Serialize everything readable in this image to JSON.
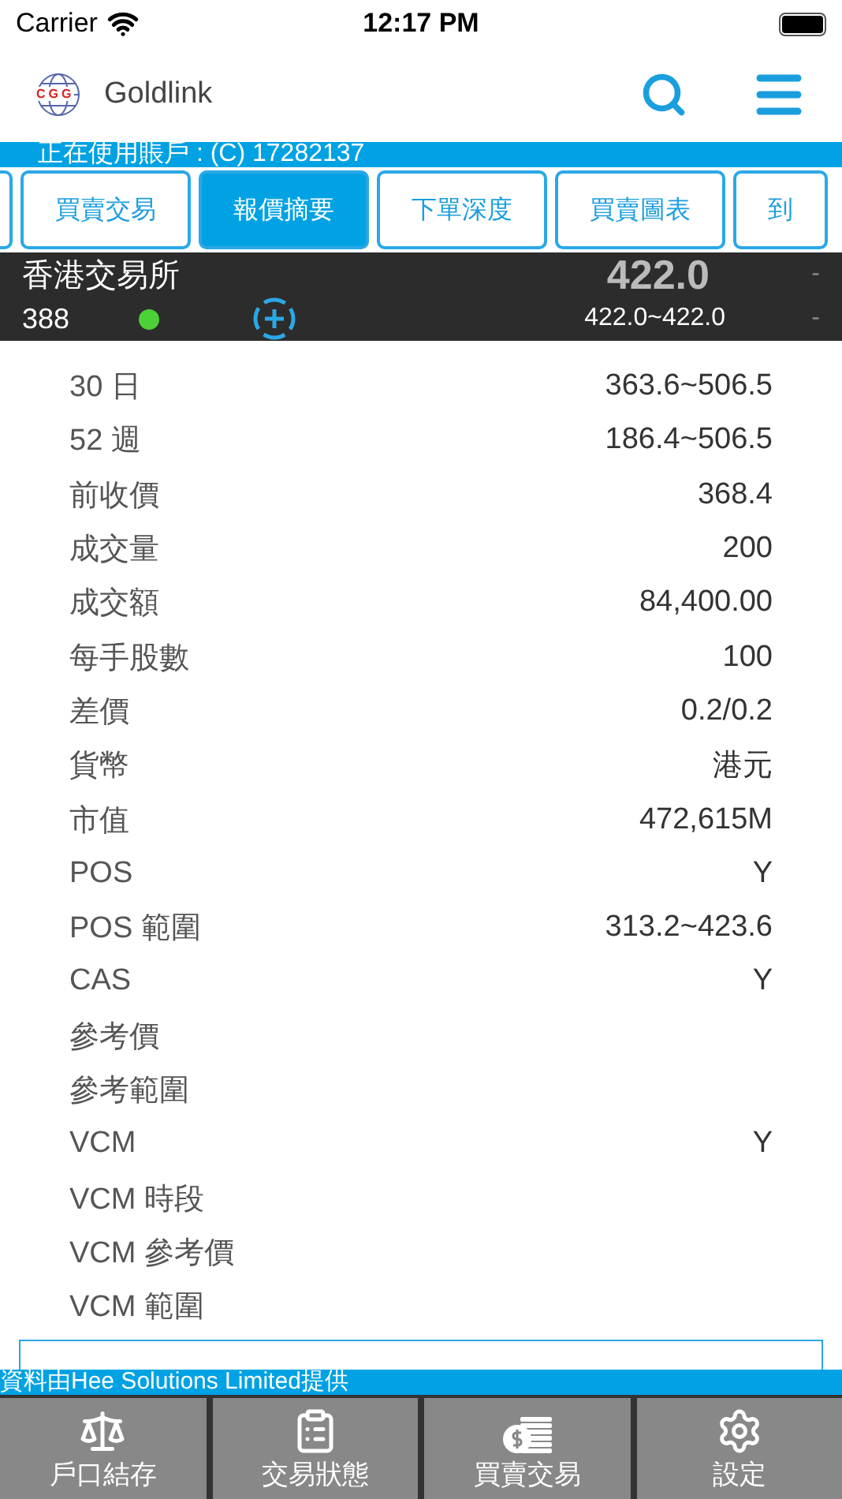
{
  "status_bar": {
    "carrier": "Carrier",
    "time": "12:17 PM"
  },
  "header": {
    "title": "Goldlink",
    "logo_text": "CGG"
  },
  "account": {
    "text": "正在使用賬戶 : (C) 17282137"
  },
  "tabs": [
    {
      "label": "買賣交易",
      "selected": false
    },
    {
      "label": "報價摘要",
      "selected": true
    },
    {
      "label": "下單深度",
      "selected": false
    },
    {
      "label": "買賣圖表",
      "selected": false
    },
    {
      "label": "到",
      "selected": false
    }
  ],
  "quote": {
    "exchange": "香港交易所",
    "code": "388",
    "live": true,
    "price": "422.0",
    "range": "422.0~422.0",
    "change": "-",
    "change_pct": "-"
  },
  "details": [
    {
      "label": "30 日",
      "value": "363.6~506.5"
    },
    {
      "label": "52 週",
      "value": "186.4~506.5"
    },
    {
      "label": "前收價",
      "value": "368.4"
    },
    {
      "label": "成交量",
      "value": "200"
    },
    {
      "label": "成交額",
      "value": "84,400.00"
    },
    {
      "label": "每手股數",
      "value": "100"
    },
    {
      "label": "差價",
      "value": "0.2/0.2"
    },
    {
      "label": "貨幣",
      "value": "港元"
    },
    {
      "label": "市值",
      "value": "472,615M"
    },
    {
      "label": "POS",
      "value": "Y"
    },
    {
      "label": "POS 範圍",
      "value": "313.2~423.6"
    },
    {
      "label": "CAS",
      "value": "Y"
    },
    {
      "label": "參考價"
    },
    {
      "label": "參考範圍"
    },
    {
      "label": "VCM",
      "value": "Y"
    },
    {
      "label": "VCM 時段"
    },
    {
      "label": "VCM 參考價"
    },
    {
      "label": "VCM 範圍"
    }
  ],
  "source": "資料由Hee Solutions Limited提供",
  "bottom_nav": [
    {
      "label": "戶口結存"
    },
    {
      "label": "交易狀態"
    },
    {
      "label": "買賣交易"
    },
    {
      "label": "設定"
    }
  ]
}
